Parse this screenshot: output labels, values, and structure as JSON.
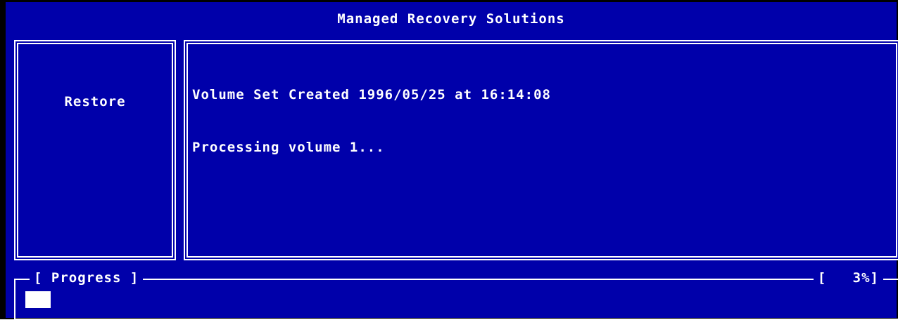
{
  "window": {
    "title": "Managed Recovery Solutions"
  },
  "side_panel": {
    "label": "Restore"
  },
  "log": {
    "lines": [
      "Volume Set Created 1996/05/25 at 16:14:08",
      "Processing volume 1..."
    ]
  },
  "progress": {
    "label": "[ Progress ]",
    "percent_text": "[   3%]",
    "value_fraction": 0.03
  },
  "colors": {
    "background": "#0000aa",
    "foreground": "#ffffff"
  }
}
